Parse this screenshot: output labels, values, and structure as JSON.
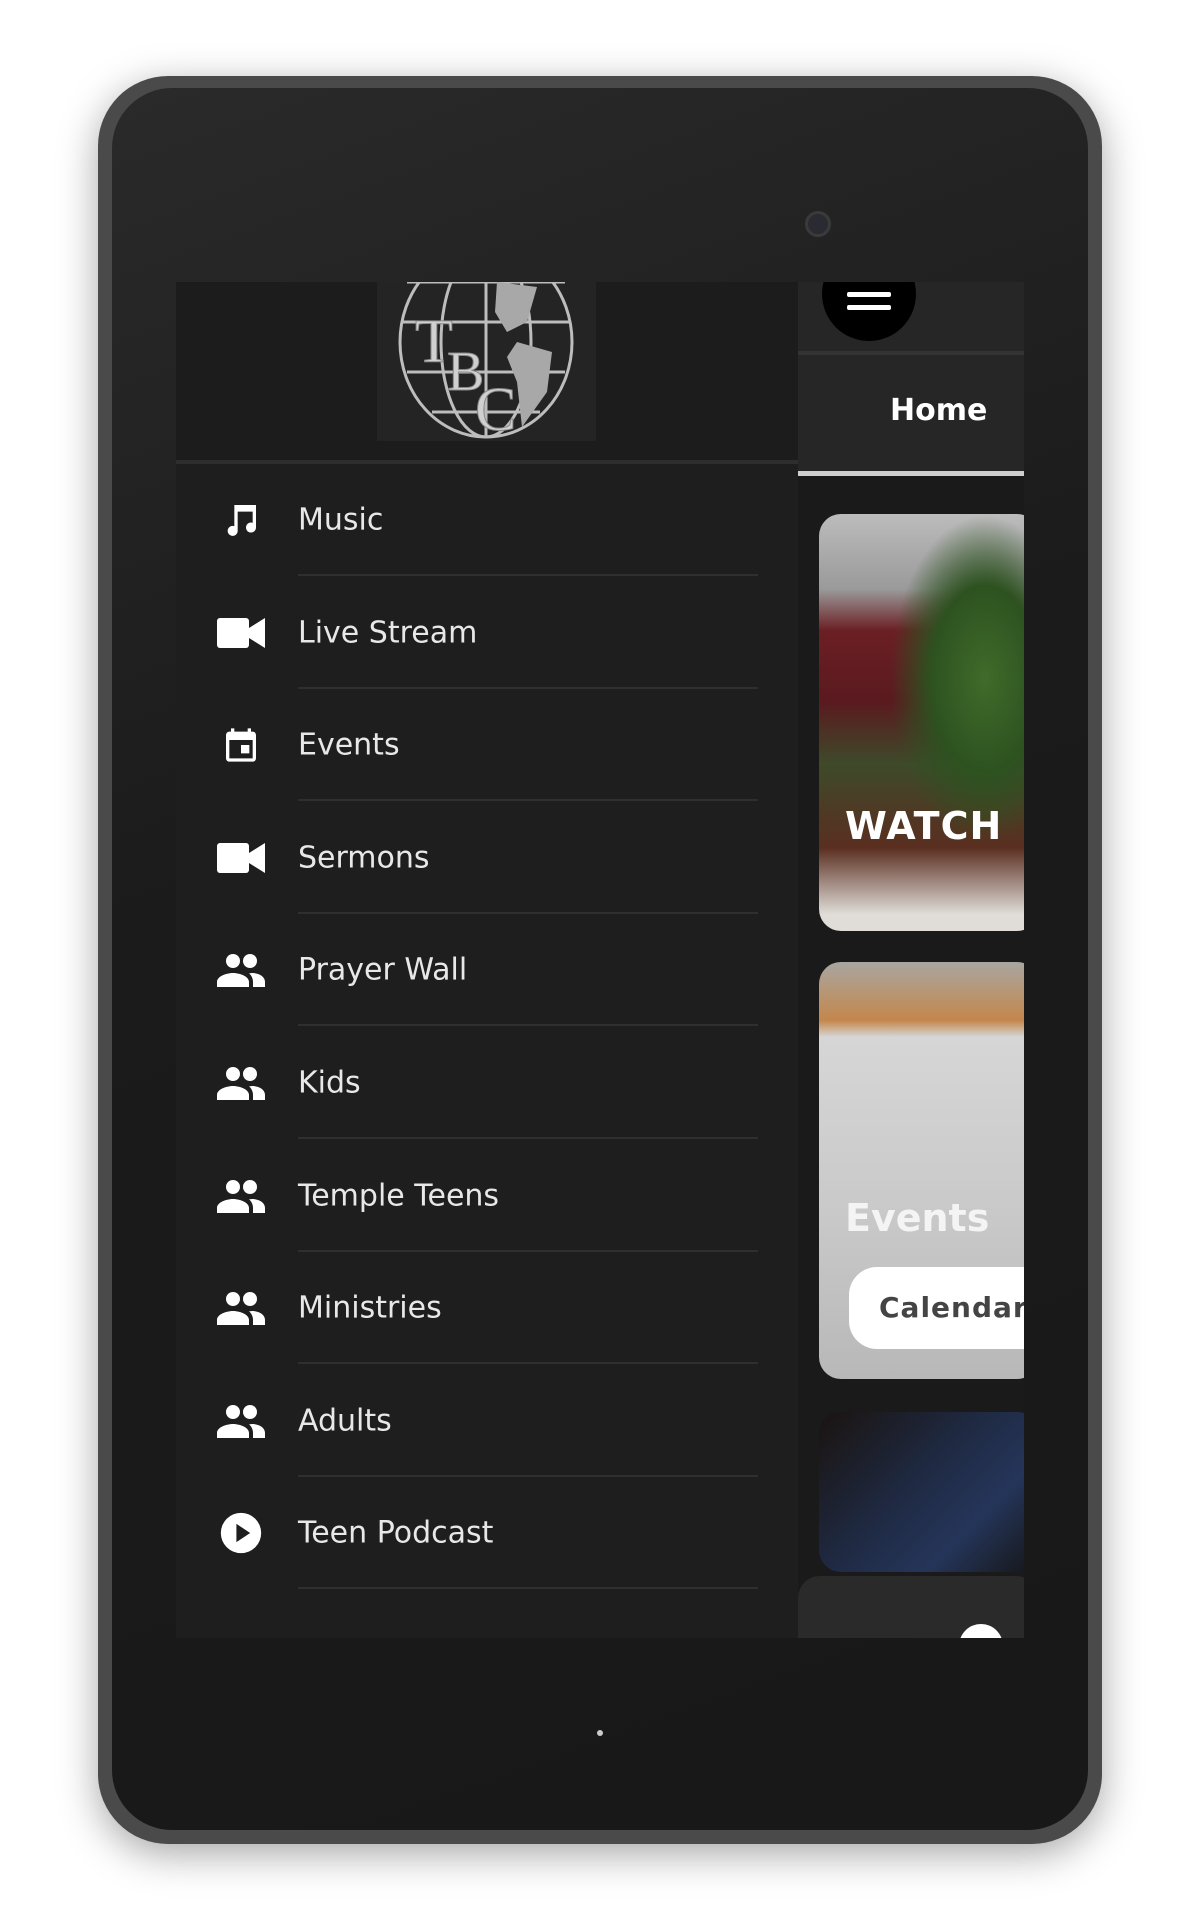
{
  "device": {
    "camera_icon": "front-camera",
    "home_indicator": "dot"
  },
  "drawer": {
    "logo_text": "TBC",
    "items": [
      {
        "label": "Music",
        "icon": "music-note-icon"
      },
      {
        "label": "Live Stream",
        "icon": "videocam-icon"
      },
      {
        "label": "Events",
        "icon": "calendar-icon"
      },
      {
        "label": "Sermons",
        "icon": "videocam-icon"
      },
      {
        "label": "Prayer Wall",
        "icon": "people-icon"
      },
      {
        "label": "Kids",
        "icon": "people-icon"
      },
      {
        "label": "Temple Teens",
        "icon": "people-icon"
      },
      {
        "label": "Ministries",
        "icon": "people-icon"
      },
      {
        "label": "Adults",
        "icon": "people-icon"
      },
      {
        "label": "Teen Podcast",
        "icon": "play-circle-icon"
      }
    ]
  },
  "main": {
    "menu_icon": "hamburger-icon",
    "tabs": [
      {
        "label": "Home",
        "active": true
      }
    ],
    "cards": [
      {
        "title": "WATCH"
      },
      {
        "title": "Events",
        "button": "Calendar"
      },
      {
        "title": ""
      }
    ]
  },
  "colors": {
    "background": "#1e1e1e",
    "text": "#e8e8e8",
    "tab_underline": "#cfcfcf"
  }
}
